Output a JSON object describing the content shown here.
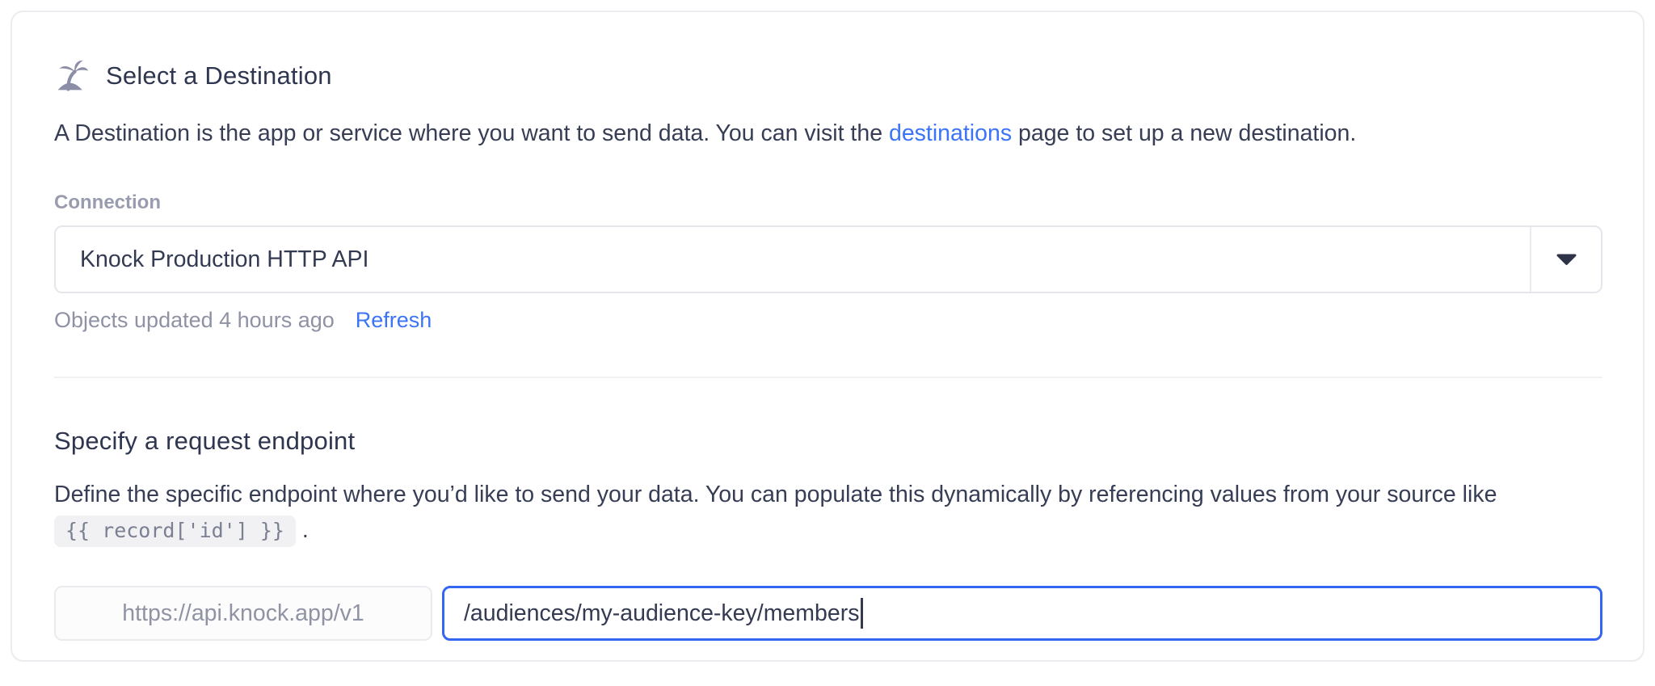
{
  "card": {
    "header": {
      "icon": "palm-island-icon",
      "title": "Select a Destination"
    },
    "description": {
      "before_link": "A Destination is the app or service where you want to send data. You can visit the ",
      "link": "destinations",
      "after_link": " page to set up a new destination."
    },
    "connection": {
      "label": "Connection",
      "selected_value": "Knock Production HTTP API",
      "status_text": "Objects updated 4 hours ago",
      "refresh_label": "Refresh"
    },
    "endpoint": {
      "heading": "Specify a request endpoint",
      "description_before_code": "Define the specific endpoint where you’d like to send your data. You can populate this dynamically by referencing values from your source like ",
      "code_snippet": "{{ record['id'] }}",
      "description_after_code": " .",
      "base_url": "https://api.knock.app/v1",
      "path_value": "/audiences/my-audience-key/members"
    }
  },
  "colors": {
    "link_blue": "#3b74f6",
    "focused_input_border": "#3566f2",
    "heading_text": "#2f3650",
    "body_text": "#363d55",
    "muted_text": "#8e92a4",
    "label_text": "#989cae",
    "icon_gray": "#8b8ea6",
    "chip_background": "#f1f1f4",
    "input_border": "#e5e6eb",
    "card_border": "#ebecf0",
    "divider": "#f1f1f4"
  }
}
